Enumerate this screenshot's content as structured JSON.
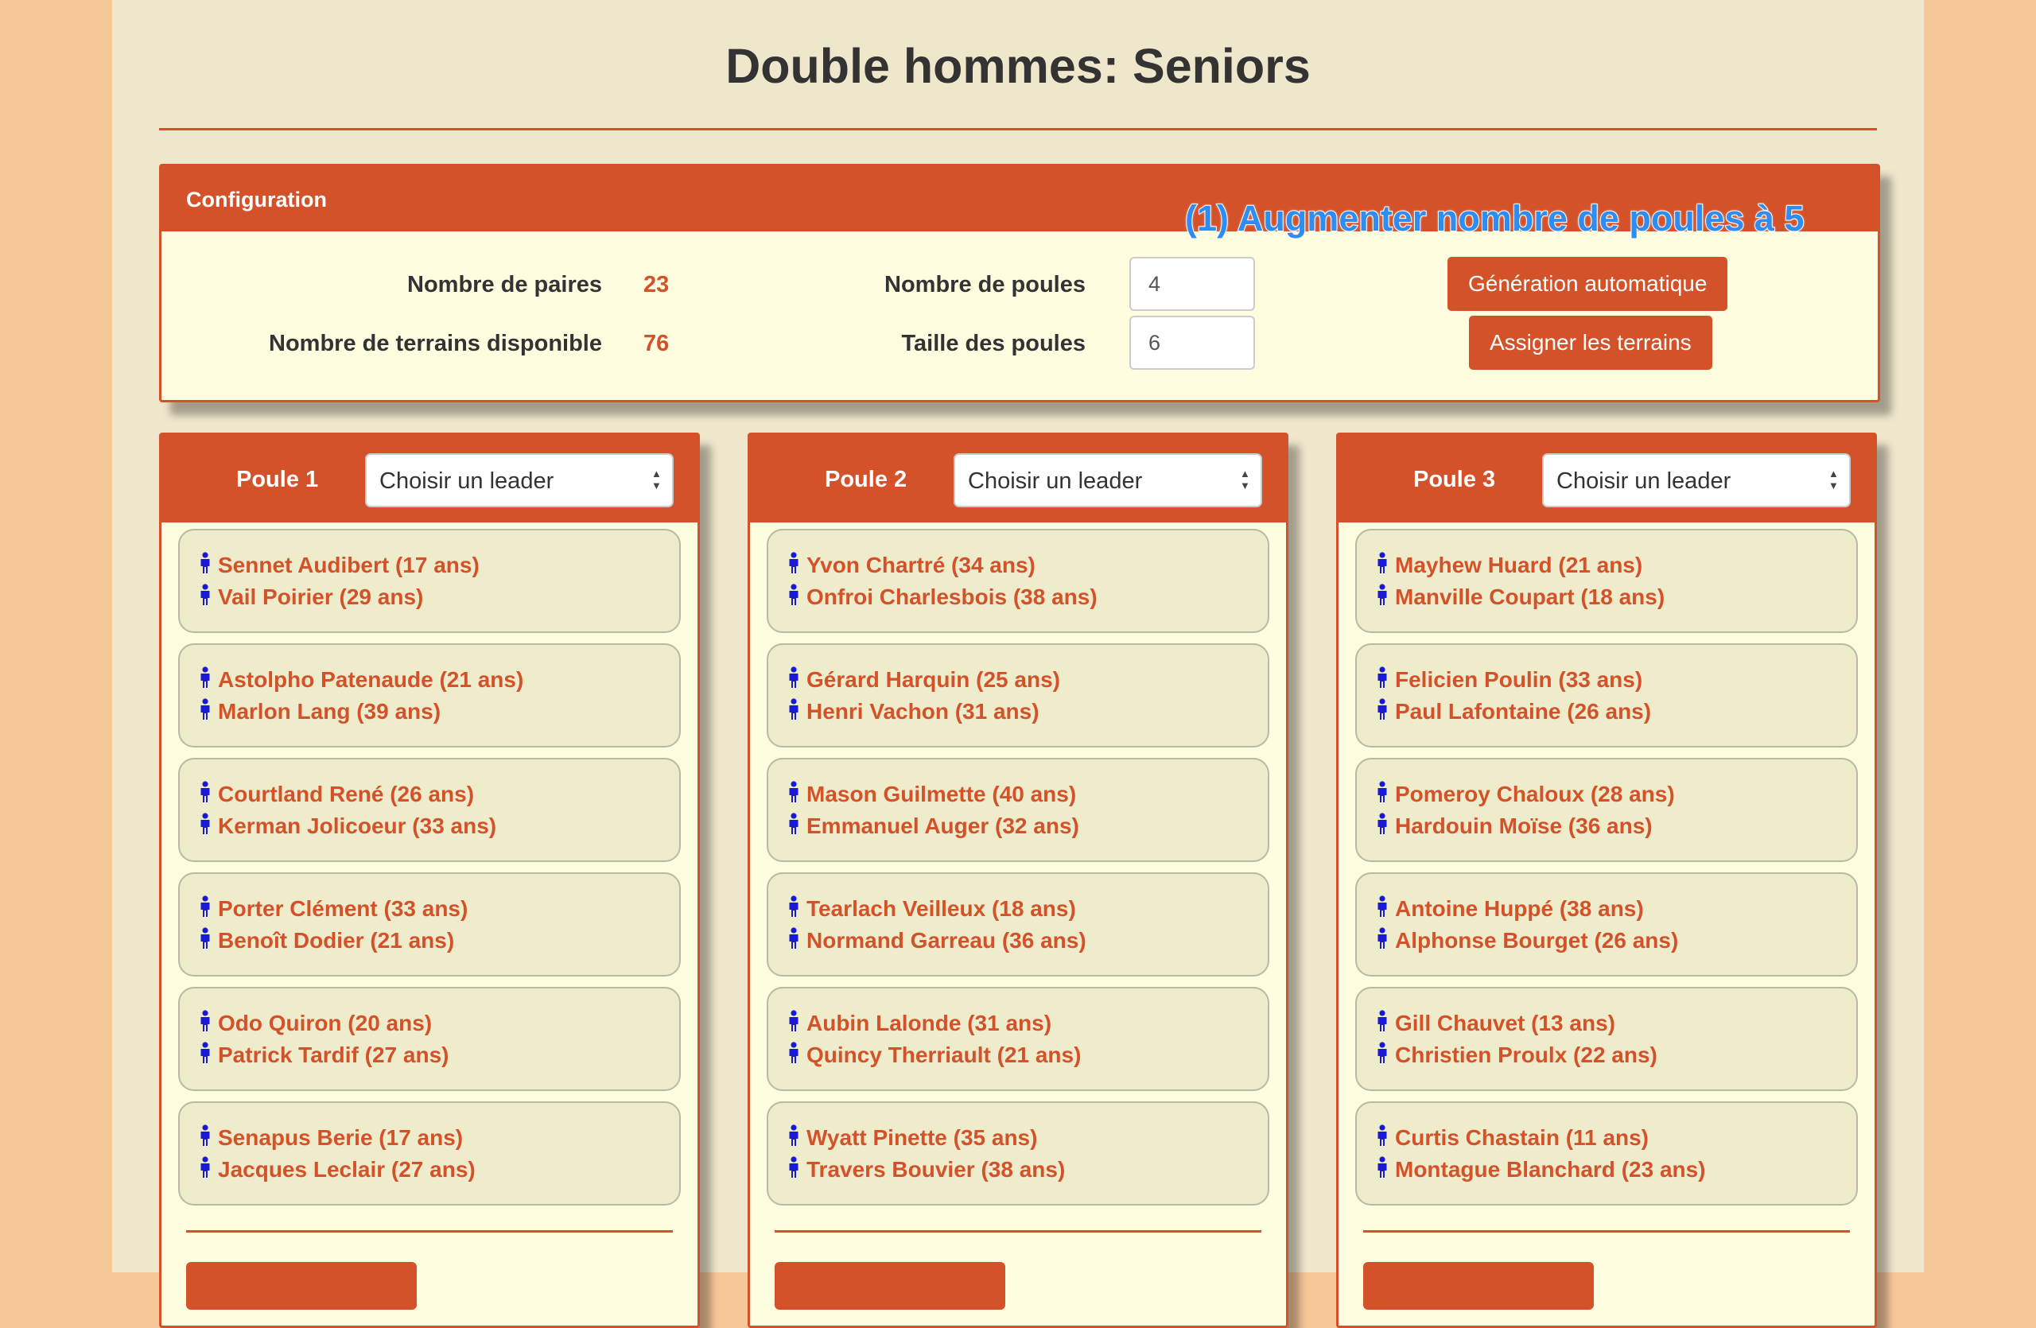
{
  "title": "Double hommes: Seniors",
  "annotation": "(1) Augmenter nombre de poules à 5",
  "config": {
    "header": "Configuration",
    "paires_label": "Nombre de paires",
    "paires_value": "23",
    "terrains_label": "Nombre de terrains disponible",
    "terrains_value": "76",
    "poules_label": "Nombre de poules",
    "poules_value": "4",
    "taille_label": "Taille des poules",
    "taille_value": "6",
    "generate_button": "Génération automatique",
    "assign_button": "Assigner les terrains"
  },
  "poules": [
    {
      "title": "Poule 1",
      "leader_placeholder": "Choisir un leader",
      "pairs": [
        [
          "Sennet Audibert (17 ans)",
          "Vail Poirier (29 ans)"
        ],
        [
          "Astolpho Patenaude (21 ans)",
          "Marlon Lang (39 ans)"
        ],
        [
          "Courtland René (26 ans)",
          "Kerman Jolicoeur (33 ans)"
        ],
        [
          "Porter Clément (33 ans)",
          "Benoît Dodier (21 ans)"
        ],
        [
          "Odo Quiron (20 ans)",
          "Patrick Tardif (27 ans)"
        ],
        [
          "Senapus Berie (17 ans)",
          "Jacques Leclair (27 ans)"
        ]
      ]
    },
    {
      "title": "Poule 2",
      "leader_placeholder": "Choisir un leader",
      "pairs": [
        [
          "Yvon Chartré (34 ans)",
          "Onfroi Charlesbois (38 ans)"
        ],
        [
          "Gérard Harquin (25 ans)",
          "Henri Vachon (31 ans)"
        ],
        [
          "Mason Guilmette (40 ans)",
          "Emmanuel Auger (32 ans)"
        ],
        [
          "Tearlach Veilleux (18 ans)",
          "Normand Garreau (36 ans)"
        ],
        [
          "Aubin Lalonde (31 ans)",
          "Quincy Therriault (21 ans)"
        ],
        [
          "Wyatt Pinette (35 ans)",
          "Travers Bouvier (38 ans)"
        ]
      ]
    },
    {
      "title": "Poule 3",
      "leader_placeholder": "Choisir un leader",
      "pairs": [
        [
          "Mayhew Huard (21 ans)",
          "Manville Coupart (18 ans)"
        ],
        [
          "Felicien Poulin (33 ans)",
          "Paul Lafontaine (26 ans)"
        ],
        [
          "Pomeroy Chaloux (28 ans)",
          "Hardouin Moïse (36 ans)"
        ],
        [
          "Antoine Huppé (38 ans)",
          "Alphonse Bourget (26 ans)"
        ],
        [
          "Gill Chauvet (13 ans)",
          "Christien Proulx (22 ans)"
        ],
        [
          "Curtis Chastain (11 ans)",
          "Montague Blanchard (23 ans)"
        ]
      ]
    }
  ],
  "colors": {
    "accent": "#d4522a",
    "panel": "#fffde0",
    "page": "#efe7cc",
    "background": "#f6c898",
    "player_icon": "#1a1ad6",
    "annotation": "#2f8cf0"
  },
  "icons": {
    "player": "person-icon",
    "select": "updown-arrows-icon"
  }
}
